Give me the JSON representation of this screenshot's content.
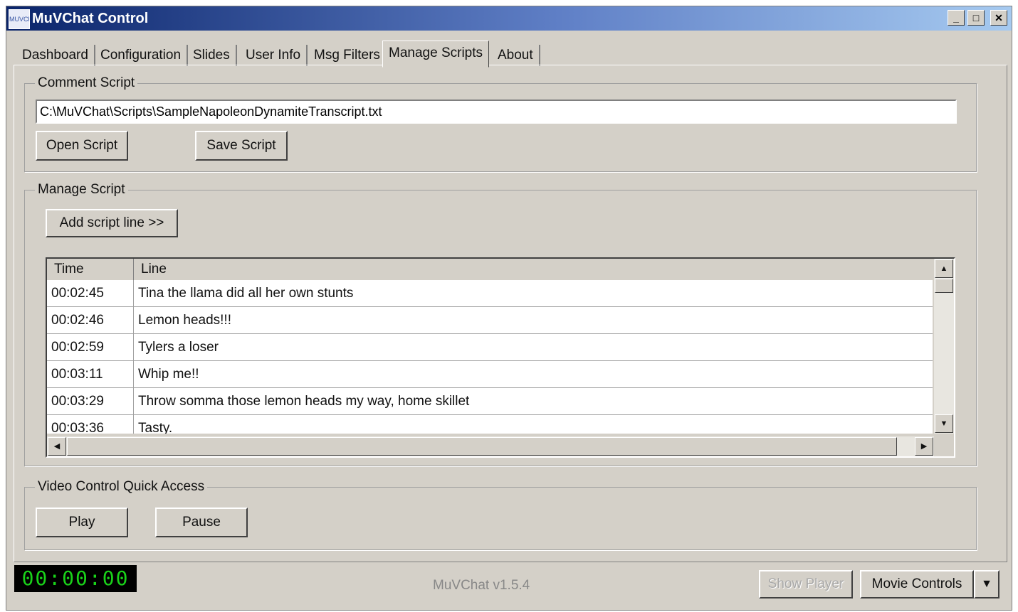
{
  "window": {
    "title": "MuVChat Control",
    "app_icon_text": "MUVChat",
    "controls": [
      "_",
      "□",
      "✕"
    ]
  },
  "tabs": [
    {
      "label": "Dashboard",
      "active": false
    },
    {
      "label": "Configuration",
      "active": false
    },
    {
      "label": "Slides",
      "active": false
    },
    {
      "label": "User Info",
      "active": false
    },
    {
      "label": "Msg Filters",
      "active": false
    },
    {
      "label": "Manage Scripts",
      "active": true
    },
    {
      "label": "About",
      "active": false
    }
  ],
  "comment_script": {
    "legend": "Comment Script",
    "path_value": "C:\\MuVChat\\Scripts\\SampleNapoleonDynamiteTranscript.txt",
    "open_button": "Open Script",
    "save_button": "Save Script"
  },
  "manage_script": {
    "legend": "Manage Script",
    "add_button": "Add script line >>",
    "columns": [
      "Time",
      "Line"
    ],
    "rows": [
      {
        "time": "00:02:45",
        "line": "Tina the llama did all her own stunts"
      },
      {
        "time": "00:02:46",
        "line": "Lemon heads!!!"
      },
      {
        "time": "00:02:59",
        "line": "Tylers a loser"
      },
      {
        "time": "00:03:11",
        "line": "Whip me!!"
      },
      {
        "time": "00:03:29",
        "line": "Throw somma those lemon heads my way, home skillet"
      },
      {
        "time": "00:03:36",
        "line": "Tasty."
      }
    ]
  },
  "video_control": {
    "legend": "Video Control Quick Access",
    "play_button": "Play",
    "pause_button": "Pause"
  },
  "status": {
    "clock": "00:00:00",
    "version": "MuVChat v1.5.4",
    "show_player_button": "Show Player",
    "movie_controls_button": "Movie Controls",
    "dropdown_arrow": "▼"
  },
  "colors": {
    "titlebar_start": "#0a246a",
    "titlebar_end": "#a6caf0",
    "face": "#d4d0c8",
    "clock_text": "#19d219"
  }
}
